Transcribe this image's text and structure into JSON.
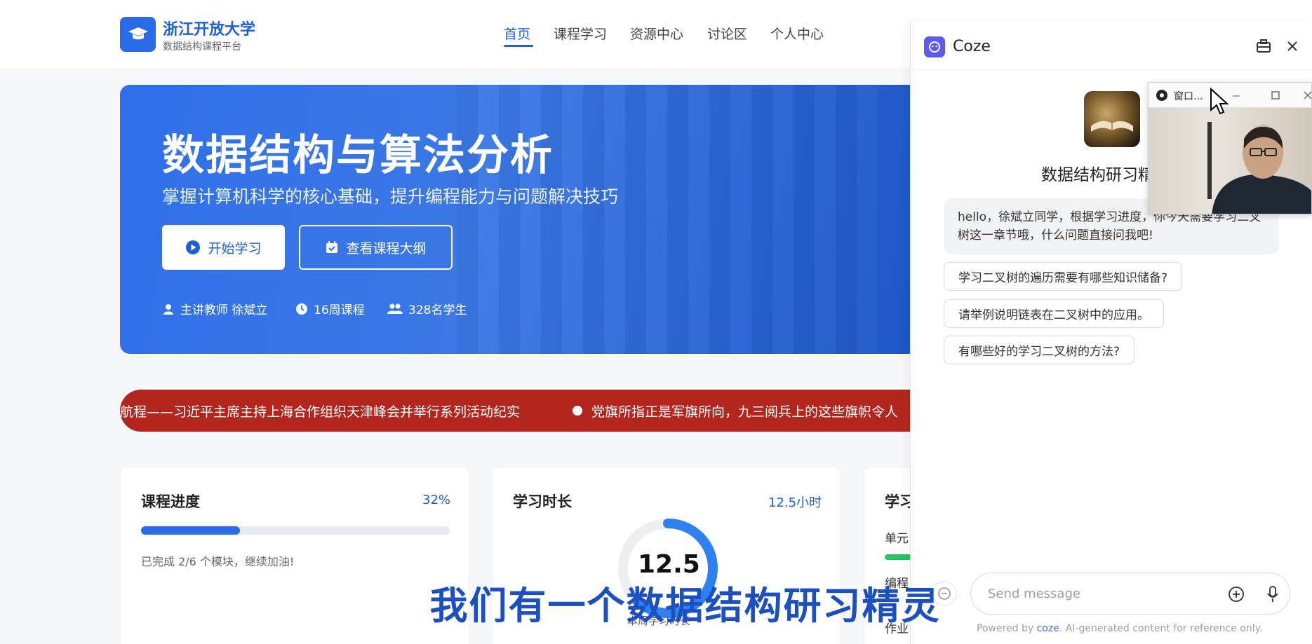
{
  "site": {
    "logo_title": "浙江开放大学",
    "logo_subtitle": "数据结构课程平台"
  },
  "nav": {
    "items": [
      {
        "label": "首页",
        "active": true
      },
      {
        "label": "课程学习"
      },
      {
        "label": "资源中心"
      },
      {
        "label": "讨论区"
      },
      {
        "label": "个人中心"
      }
    ]
  },
  "hero": {
    "title": "数据结构与算法分析",
    "subtitle": "掌握计算机科学的核心基础，提升编程能力与问题解决技巧",
    "start_button": "开始学习",
    "syllabus_button": "查看课程大纲",
    "meta": {
      "teacher": "主讲教师 徐斌立",
      "weeks": "16周课程",
      "students": "328名学生"
    }
  },
  "ticker": {
    "item_a": "航程——习近平主席主持上海合作组织天津峰会并举行系列活动纪实",
    "item_b": "党旗所指正是军旗所向，九三阅兵上的这些旗帜令人"
  },
  "cards": {
    "progress": {
      "title": "课程进度",
      "value": "32%",
      "fraction": 0.32,
      "note": "已完成 2/6 个模块，继续加油!"
    },
    "study_time": {
      "title": "学习时长",
      "value": "12.5小时",
      "ring_value": "12.5",
      "caption": "本周学习时长",
      "ring_fraction": 0.62
    },
    "third": {
      "title": "学习",
      "line1": "单元",
      "line2": "编程",
      "line3": "作业"
    }
  },
  "subtitle_caption": "我们有一个数据结构研习精灵",
  "coze": {
    "title": "Coze",
    "bot_name": "数据结构研习精灵",
    "greeting": "hello，徐斌立同学，根据学习进度，你今天需要学习二叉树这一章节哦，什么问题直接问我吧!",
    "suggestions": [
      "学习二叉树的遍历需要有哪些知识储备?",
      "请举例说明链表在二叉树中的应用。",
      "有哪些好的学习二叉树的方法?"
    ],
    "input_placeholder": "Send message",
    "footer_prefix": "Powered by ",
    "footer_brand": "coze",
    "footer_suffix": ". AI-generated content for reference only."
  },
  "video_window": {
    "title": "窗口..."
  },
  "colors": {
    "primary": "#1e5fd6",
    "ticker": "#b3261e",
    "progress": "#2a6be8",
    "green": "#22c55e"
  }
}
